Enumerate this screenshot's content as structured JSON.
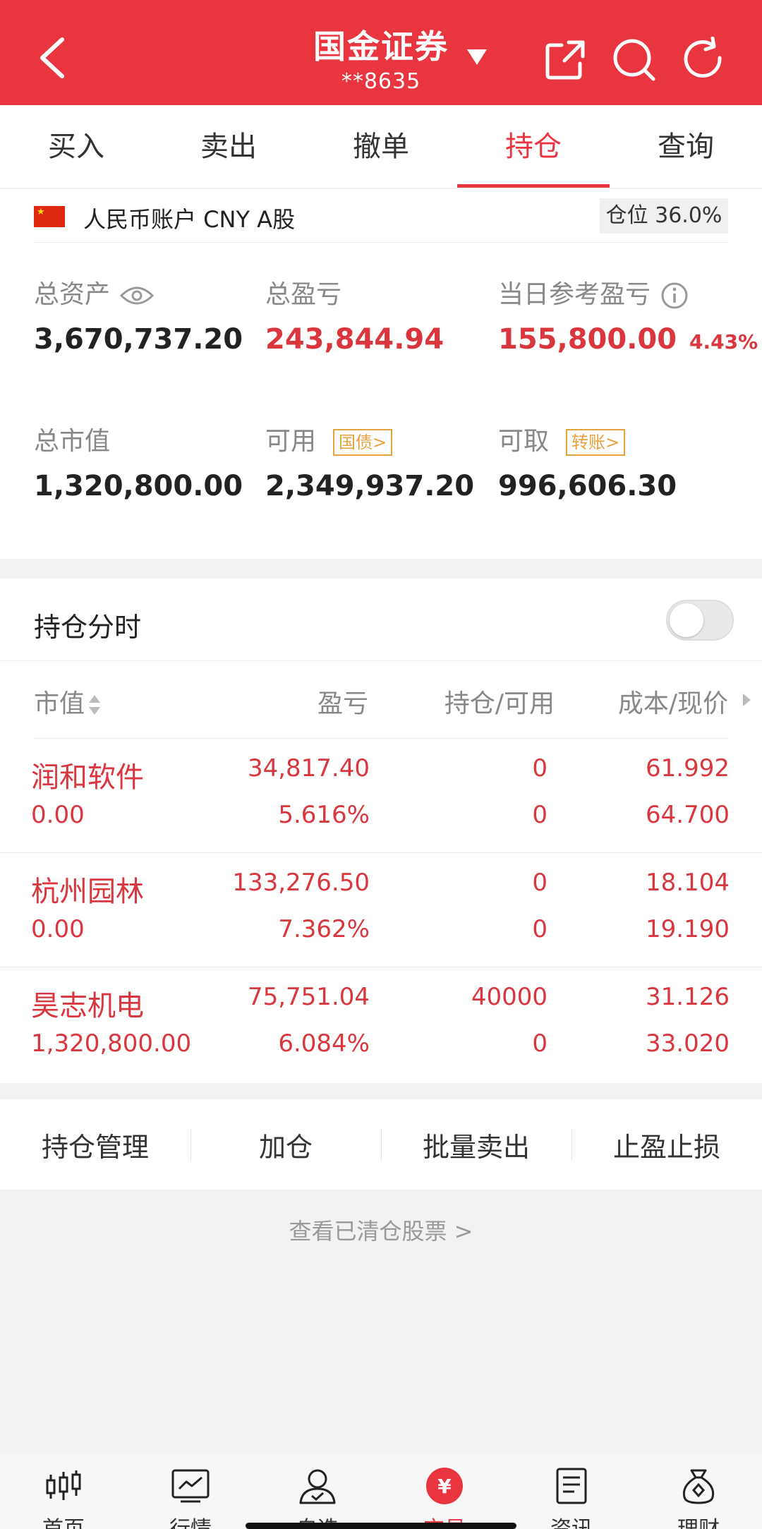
{
  "header": {
    "title": "国金证券",
    "account": "**8635",
    "icons": [
      "back-icon",
      "dropdown-caret-icon",
      "share-icon",
      "search-icon",
      "refresh-icon"
    ]
  },
  "tabs": [
    {
      "label": "买入",
      "active": false
    },
    {
      "label": "卖出",
      "active": false
    },
    {
      "label": "撤单",
      "active": false
    },
    {
      "label": "持仓",
      "active": true
    },
    {
      "label": "查询",
      "active": false
    }
  ],
  "account": {
    "label": "人民币账户 CNY A股",
    "position": "仓位 36.0%",
    "position_fraction": 0.36
  },
  "metrics": {
    "total_assets": {
      "label": "总资产",
      "value": "3,670,737.20"
    },
    "total_pnl": {
      "label": "总盈亏",
      "value": "243,844.94"
    },
    "daily_pnl": {
      "label": "当日参考盈亏",
      "value": "155,800.00",
      "pct": "4.43%"
    },
    "market_value": {
      "label": "总市值",
      "value": "1,320,800.00"
    },
    "available": {
      "label": "可用",
      "tag": "国债>",
      "value": "2,349,937.20"
    },
    "withdrawable": {
      "label": "可取",
      "tag": "转账>",
      "value": "996,606.30"
    }
  },
  "holdings": {
    "title": "持仓分时",
    "toggle_on": false,
    "columns": [
      "市值",
      "盈亏",
      "持仓/可用",
      "成本/现价"
    ],
    "rows": [
      {
        "name": "润和软件",
        "market_value": "0.00",
        "pnl": "34,817.40",
        "pnl_pct": "5.616%",
        "position": "0",
        "available": "0",
        "cost": "61.992",
        "price": "64.700"
      },
      {
        "name": "杭州园林",
        "market_value": "0.00",
        "pnl": "133,276.50",
        "pnl_pct": "7.362%",
        "position": "0",
        "available": "0",
        "cost": "18.104",
        "price": "19.190"
      },
      {
        "name": "昊志机电",
        "market_value": "1,320,800.00",
        "pnl": "75,751.04",
        "pnl_pct": "6.084%",
        "position": "40000",
        "available": "0",
        "cost": "31.126",
        "price": "33.020"
      }
    ]
  },
  "actions": [
    "持仓管理",
    "加仓",
    "批量卖出",
    "止盈止损"
  ],
  "cleared_link": "查看已清仓股票  >",
  "bottom_nav": [
    {
      "label": "首页",
      "icon": "candlestick-icon",
      "active": false
    },
    {
      "label": "行情",
      "icon": "chart-icon",
      "active": false
    },
    {
      "label": "自选",
      "icon": "user-icon",
      "active": false
    },
    {
      "label": "交易",
      "icon": "yuan-icon",
      "active": true
    },
    {
      "label": "资讯",
      "icon": "document-icon",
      "active": false
    },
    {
      "label": "理财",
      "icon": "money-bag-icon",
      "active": false
    }
  ],
  "colors": {
    "brand_red": "#e8353f",
    "profit_red": "#d9363e",
    "tag_orange": "#e6a23c"
  }
}
